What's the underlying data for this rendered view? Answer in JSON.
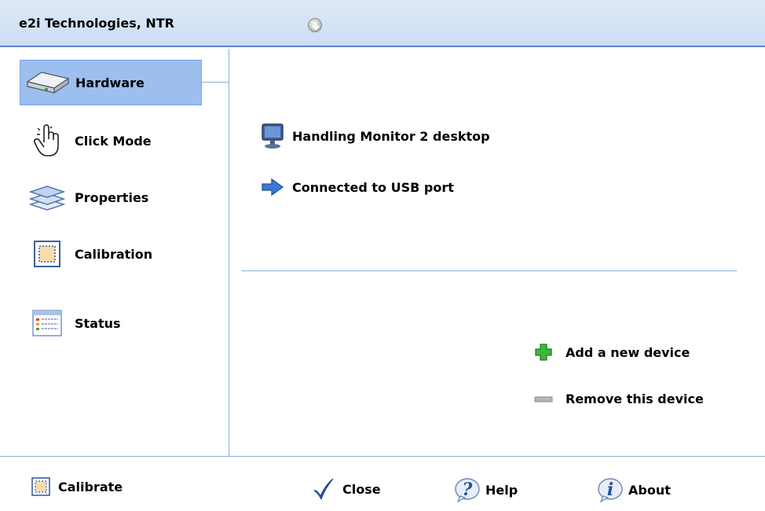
{
  "header": {
    "title": "e2i Technologies, NTR",
    "menu_icon": "chevron-down-circle-icon"
  },
  "sidebar": {
    "items": [
      {
        "label": "Hardware",
        "icon": "hardware-drive-icon",
        "active": true
      },
      {
        "label": "Click Mode",
        "icon": "hand-pointer-icon",
        "active": false
      },
      {
        "label": "Properties",
        "icon": "layers-icon",
        "active": false
      },
      {
        "label": "Calibration",
        "icon": "calibration-icon",
        "active": false
      },
      {
        "label": "Status",
        "icon": "status-list-icon",
        "active": false
      }
    ]
  },
  "main": {
    "device_name": "Handling Monitor 2 desktop",
    "connection": "Connected to USB port",
    "actions": {
      "add": "Add a new device",
      "remove": "Remove this device"
    }
  },
  "footer": {
    "calibrate": "Calibrate",
    "close": "Close",
    "help": "Help",
    "about": "About"
  },
  "colors": {
    "accent": "#9cbff0",
    "divider": "#87aee0",
    "titlebar": "#cbdcf3",
    "add_green": "#3cb83c"
  }
}
